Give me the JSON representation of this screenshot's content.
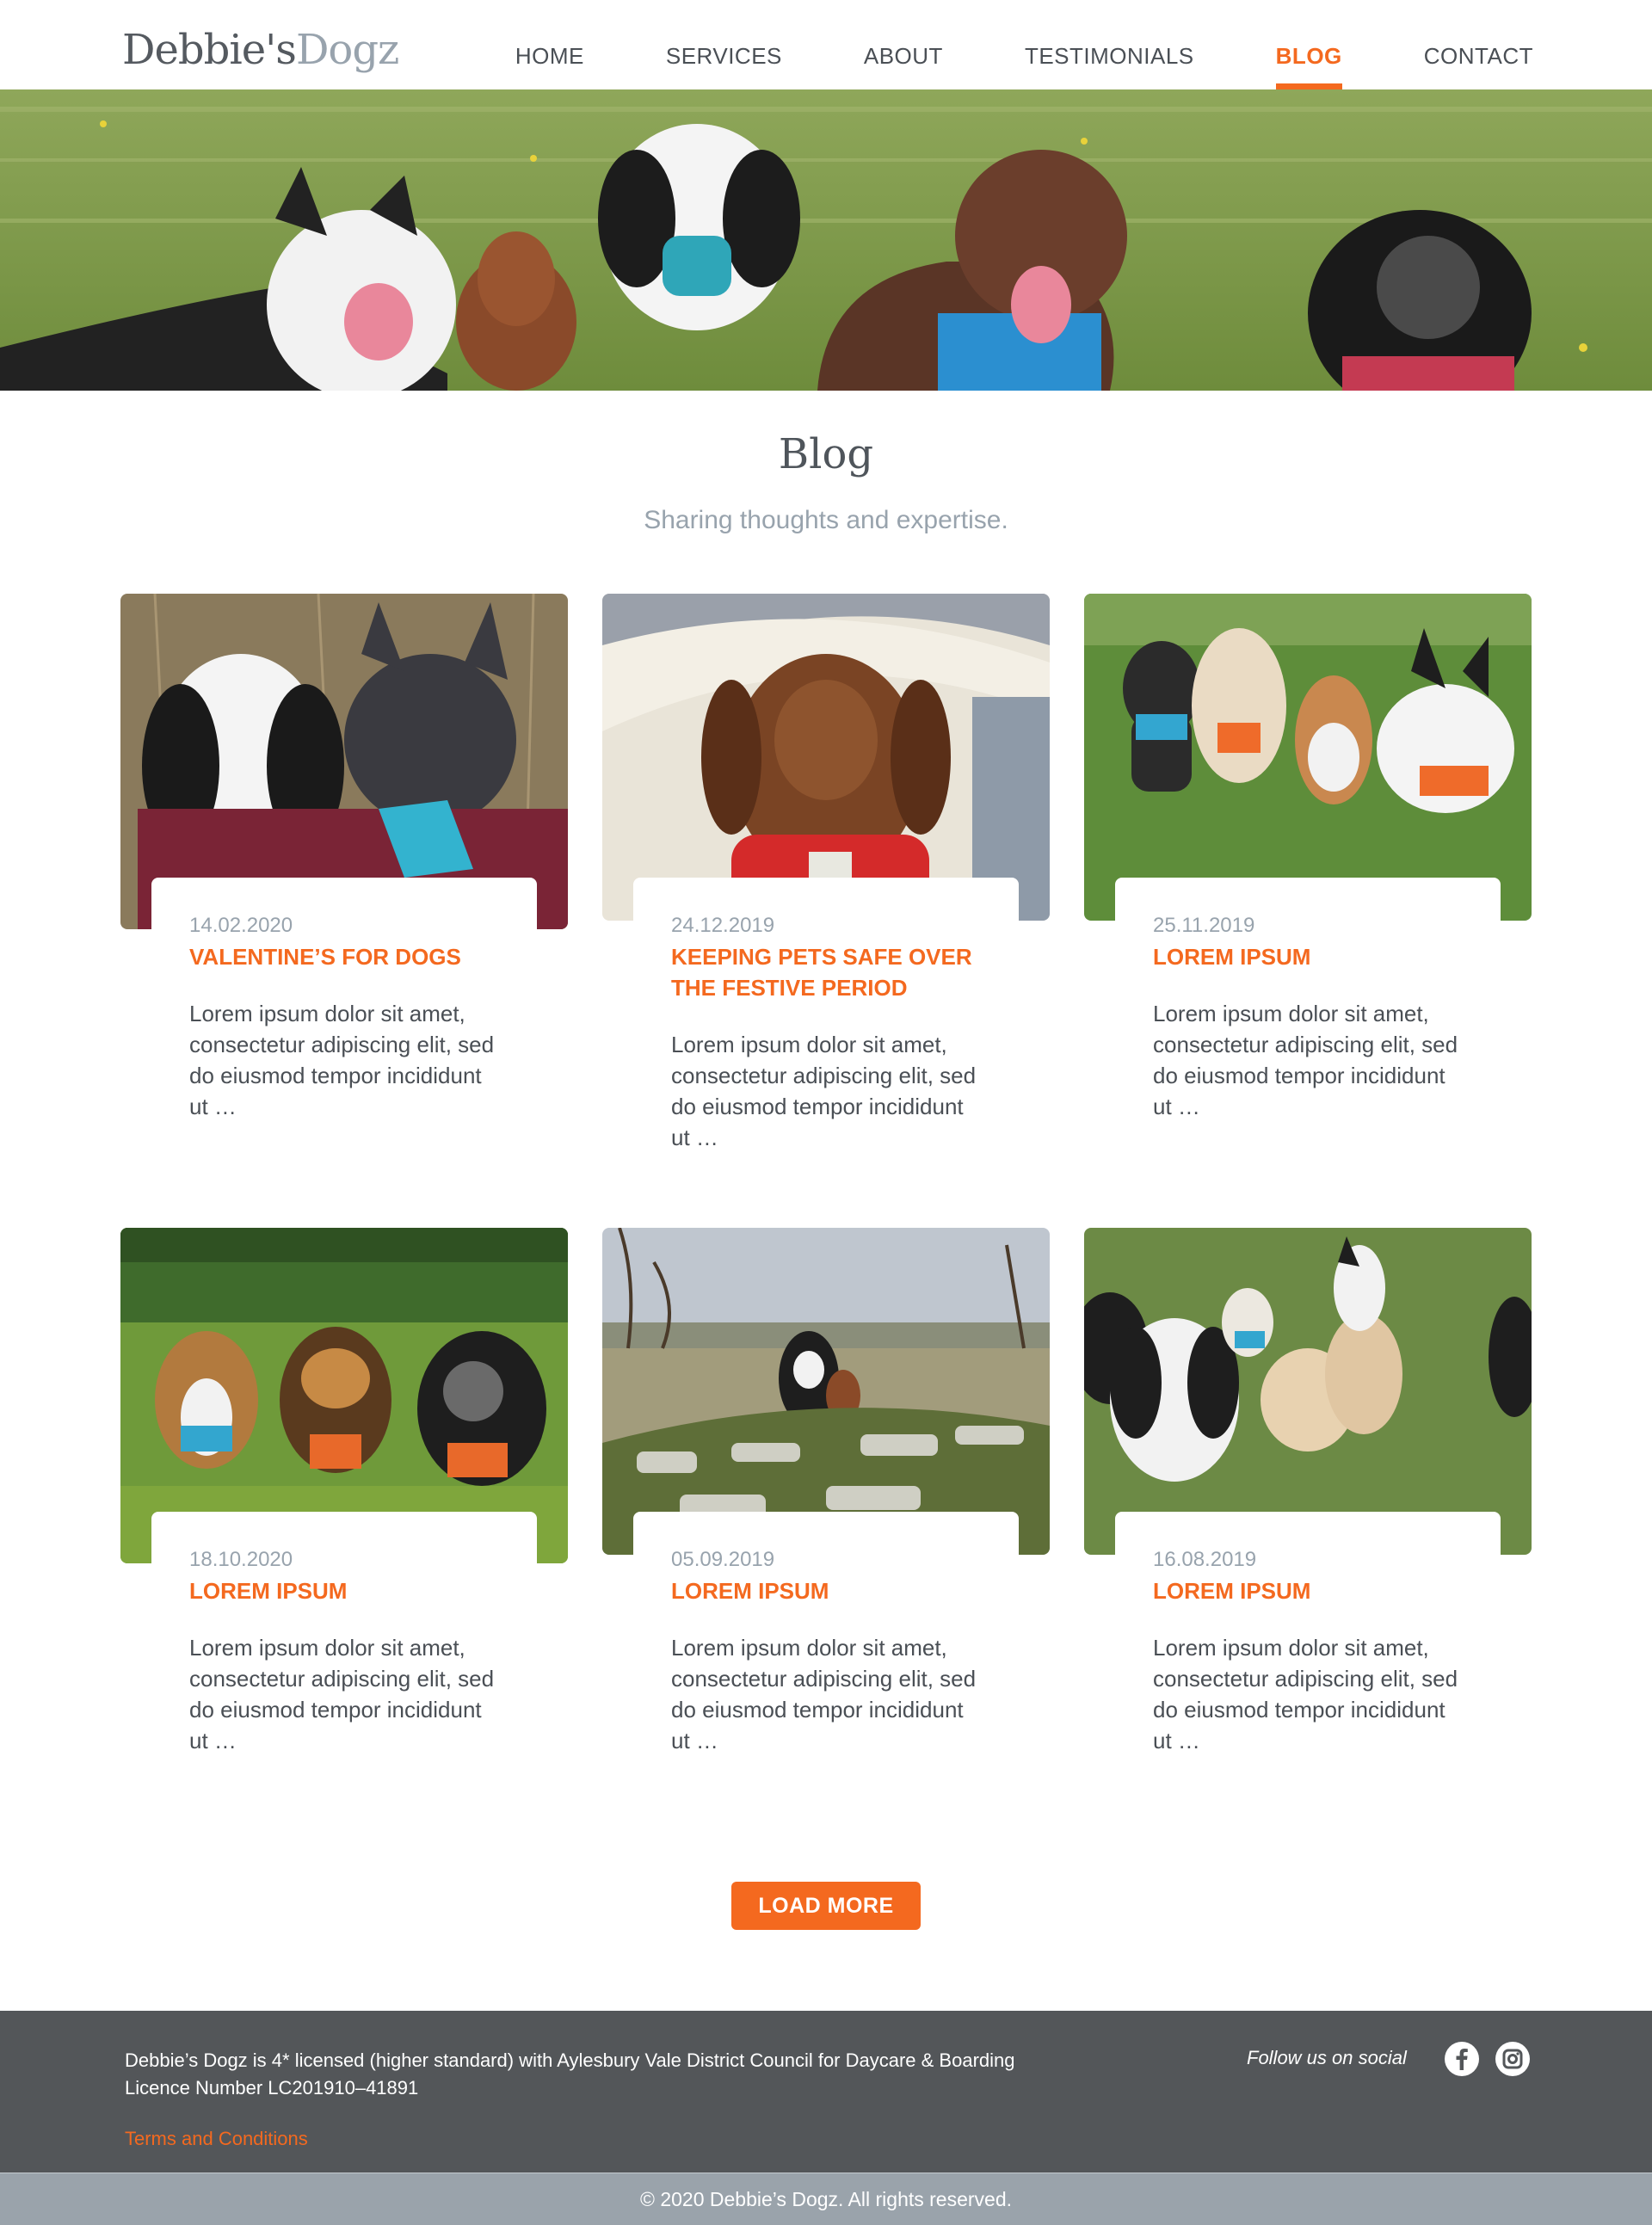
{
  "brand": {
    "name_part1": "Debbie's",
    "name_part2": "Dogz"
  },
  "nav": {
    "items": [
      {
        "label": "HOME"
      },
      {
        "label": "SERVICES"
      },
      {
        "label": "ABOUT"
      },
      {
        "label": "TESTIMONIALS"
      },
      {
        "label": "BLOG",
        "active": true
      },
      {
        "label": "CONTACT"
      }
    ]
  },
  "page": {
    "title": "Blog",
    "subtitle": "Sharing thoughts and expertise."
  },
  "posts": [
    {
      "date": "14.02.2020",
      "title": "VALENTINE’S FOR DOGS",
      "excerpt": "Lorem ipsum dolor sit amet, consectetur adipiscing elit, sed do eiusmod tempor incididunt ut …"
    },
    {
      "date": "24.12.2019",
      "title": "KEEPING PETS SAFE OVER THE FESTIVE PERIOD",
      "excerpt": "Lorem ipsum dolor sit amet, consectetur adipiscing elit, sed do eiusmod tempor incididunt ut …"
    },
    {
      "date": "25.11.2019",
      "title": "LOREM IPSUM",
      "excerpt": "Lorem ipsum dolor sit amet, consectetur adipiscing elit, sed do eiusmod tempor incididunt ut …"
    },
    {
      "date": "18.10.2020",
      "title": "LOREM IPSUM",
      "excerpt": "Lorem ipsum dolor sit amet, consectetur adipiscing elit, sed do eiusmod tempor incididunt ut …"
    },
    {
      "date": "05.09.2019",
      "title": "LOREM IPSUM",
      "excerpt": "Lorem ipsum dolor sit amet, consectetur adipiscing elit, sed do eiusmod tempor incididunt ut …"
    },
    {
      "date": "16.08.2019",
      "title": "LOREM IPSUM",
      "excerpt": "Lorem ipsum dolor sit amet, consectetur adipiscing elit, sed do eiusmod tempor incididunt ut …"
    }
  ],
  "load_more_label": "LOAD MORE",
  "footer": {
    "license_line1": "Debbie’s Dogz is 4* licensed (higher standard) with Aylesbury Vale District Council for Daycare & Boarding",
    "license_line2": "Licence Number LC201910–41891",
    "terms_label": "Terms and Conditions",
    "follow_label": "Follow us on social",
    "social_icons": [
      "facebook-icon",
      "instagram-icon"
    ],
    "copyright": "© 2020 Debbie’s Dogz. All rights reserved."
  },
  "colors": {
    "accent": "#f4691f",
    "footer_bg": "#535659",
    "copyright_bg": "#9aa3ab",
    "muted_text": "#98a3ad",
    "body_text": "#4a4f55"
  }
}
